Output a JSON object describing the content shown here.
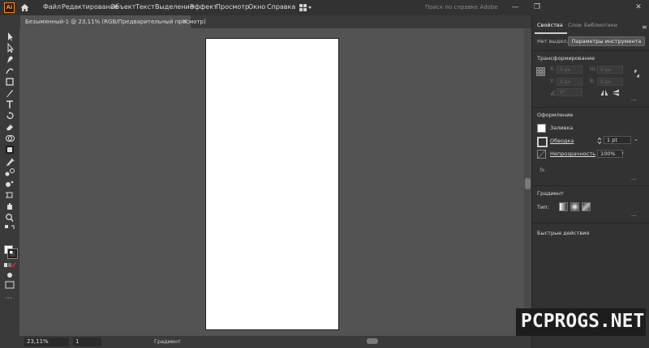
{
  "app": {
    "logo_text": "Ai"
  },
  "menu": {
    "items": [
      "Файл",
      "Редактирование",
      "Объект",
      "Текст",
      "Выделение",
      "Эффект",
      "Просмотр",
      "Окно",
      "Справка"
    ],
    "search_placeholder": "Поиск по справке Adobe"
  },
  "window_controls": {
    "minimize": "—",
    "restore": "❐",
    "close": "✕"
  },
  "document_tab": {
    "title": "Безымянный-1 @ 23,11% (RGB/Предварительный просмотр)",
    "close": "✕"
  },
  "status_bar": {
    "zoom": "23,11%",
    "page": "1",
    "status_text": "Градиент"
  },
  "panel": {
    "tabs": [
      "Свойства",
      "Слои",
      "Библиотеки"
    ],
    "active_tab": "Свойства",
    "no_selection": "Нет выдел...",
    "tool_params_button": "Параметры инструмента",
    "transform": {
      "title": "Трансформирование",
      "x_label": "X:",
      "y_label": "Y:",
      "w_label": "Ш:",
      "h_label": "В:",
      "x_value": "0 px",
      "y_value": "0 px",
      "w_value": "0 px",
      "h_value": "0 px",
      "angle_value": "0°"
    },
    "appearance": {
      "title": "Оформление",
      "fill_label": "Заливка",
      "stroke_label": "Обводка",
      "stroke_value": "1 pt",
      "opacity_label": "Непрозрачность",
      "opacity_value": "100%",
      "fx_label": "fx."
    },
    "gradient": {
      "title": "Градиент",
      "type_label": "Тип:"
    },
    "quick_actions": {
      "title": "Быстрые действия"
    },
    "more_icon": "···"
  },
  "watermark": {
    "text": "PCPROGS.NET"
  },
  "colors": {
    "accent_orange": "#f28b25",
    "panel_bg": "#323232",
    "canvas_bg": "#535353"
  }
}
